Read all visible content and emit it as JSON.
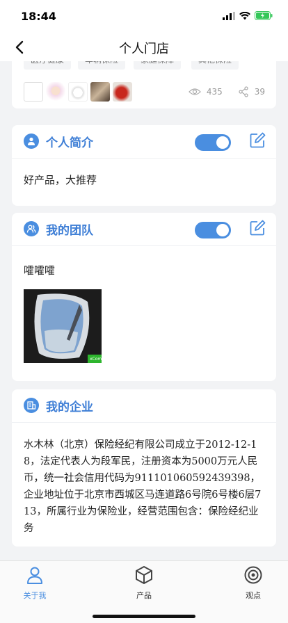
{
  "status": {
    "time": "18:44"
  },
  "nav": {
    "title": "个人门店"
  },
  "tags": [
    "医疗健康",
    "车辆保险",
    "家庭保障",
    "其他保险"
  ],
  "stats": {
    "views": "435",
    "shares": "39"
  },
  "intro": {
    "title": "个人简介",
    "text": "好产品，大推荐"
  },
  "team": {
    "title": "我的团队",
    "text": "嚯嚯嚯",
    "photo_badge": "xCom"
  },
  "company": {
    "title": "我的企业",
    "text": "水木林（北京）保险经纪有限公司成立于2012-12-18，法定代表人为段军民，注册资本为5000万元人民币，统一社会信用代码为911101060592439398，企业地址位于北京市西城区马连道路6号院6号楼6层713，所属行业为保险业，经营范围包含：保险经纪业务"
  },
  "tabs": [
    {
      "label": "关于我",
      "icon": "person-icon",
      "active": true
    },
    {
      "label": "产品",
      "icon": "box-icon",
      "active": false
    },
    {
      "label": "观点",
      "icon": "target-icon",
      "active": false
    }
  ],
  "colors": {
    "accent": "#4a8ee0",
    "title_blue": "#3f7fd6"
  }
}
